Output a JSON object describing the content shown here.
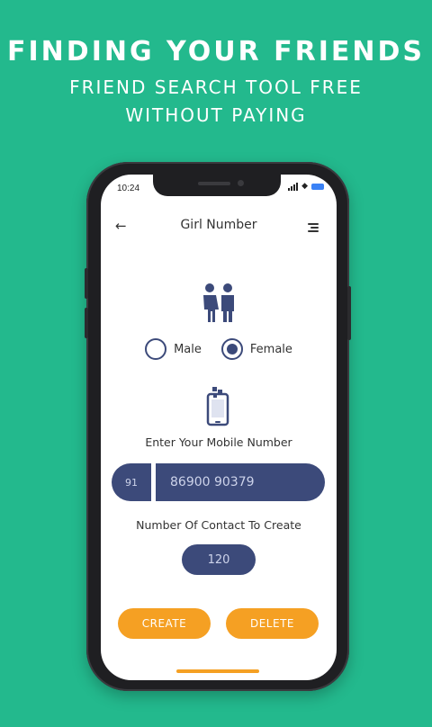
{
  "promo": {
    "title": "FINDING YOUR FRIENDS",
    "subtitle_line1": "FRIEND SEARCH TOOL FREE",
    "subtitle_line2": "WITHOUT PAYING"
  },
  "status_bar": {
    "time": "10:24"
  },
  "app_bar": {
    "title": "Girl Number"
  },
  "gender": {
    "options": [
      {
        "label": "Male",
        "checked": false
      },
      {
        "label": "Female",
        "checked": true
      }
    ]
  },
  "mobile": {
    "label": "Enter Your Mobile Number",
    "country_code": "91",
    "number": "86900 90379"
  },
  "contacts": {
    "label": "Number Of Contact To Create",
    "count": "120"
  },
  "actions": {
    "create_label": "CREATE",
    "delete_label": "DELETE"
  },
  "colors": {
    "background": "#23b98d",
    "primary": "#3c4a7a",
    "accent": "#f5a023"
  }
}
